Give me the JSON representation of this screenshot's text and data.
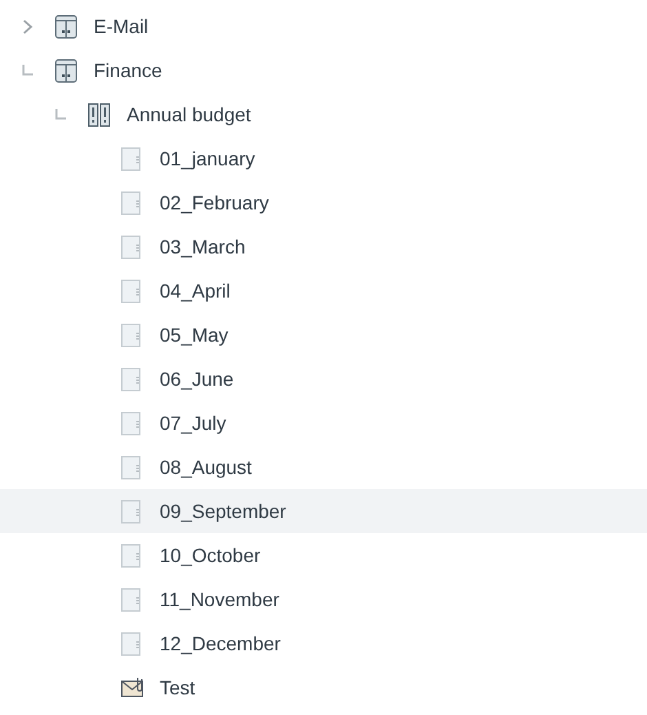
{
  "tree": [
    {
      "label": "E-Mail",
      "kind": "cabinet",
      "expanded": false,
      "selected": false
    },
    {
      "label": "Finance",
      "kind": "cabinet",
      "expanded": true,
      "selected": false,
      "children": [
        {
          "label": "Annual budget",
          "kind": "binder",
          "expanded": true,
          "selected": false,
          "children": [
            {
              "label": "01_january",
              "kind": "document",
              "selected": false
            },
            {
              "label": "02_February",
              "kind": "document",
              "selected": false
            },
            {
              "label": "03_March",
              "kind": "document",
              "selected": false
            },
            {
              "label": "04_April",
              "kind": "document",
              "selected": false
            },
            {
              "label": "05_May",
              "kind": "document",
              "selected": false
            },
            {
              "label": "06_June",
              "kind": "document",
              "selected": false
            },
            {
              "label": "07_July",
              "kind": "document",
              "selected": false
            },
            {
              "label": "08_August",
              "kind": "document",
              "selected": false
            },
            {
              "label": "09_September",
              "kind": "document",
              "selected": true
            },
            {
              "label": "10_October",
              "kind": "document",
              "selected": false
            },
            {
              "label": "11_November",
              "kind": "document",
              "selected": false
            },
            {
              "label": "12_December",
              "kind": "document",
              "selected": false
            },
            {
              "label": "Test",
              "kind": "email",
              "selected": false
            }
          ]
        }
      ]
    }
  ]
}
